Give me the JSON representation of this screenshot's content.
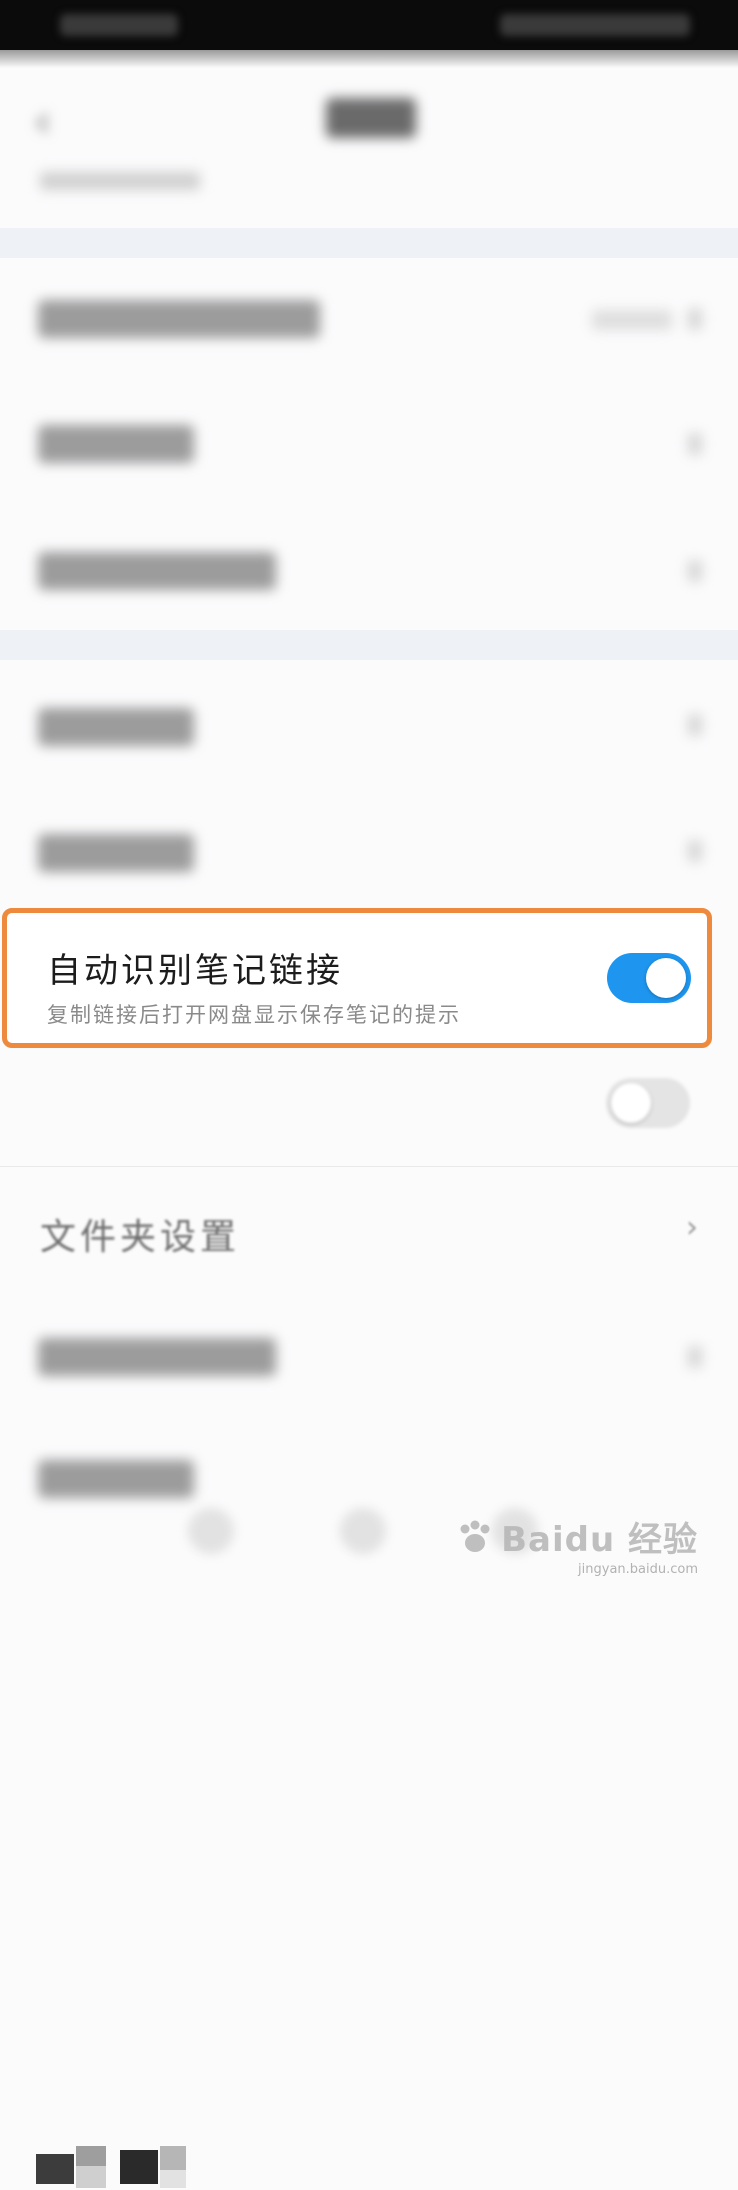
{
  "settings": {
    "auto_link": {
      "title": "自动识别笔记链接",
      "description": "复制链接后打开网盘显示保存笔记的提示",
      "toggle_on": true
    },
    "night_mode": {
      "toggle_on": false
    },
    "folder": {
      "title": "文件夹设置",
      "chevron": "›"
    }
  },
  "header": {
    "back_glyph": "‹"
  },
  "watermark": {
    "brand": "Baidu 经验",
    "site": "jingyan.baidu.com"
  },
  "colors": {
    "accent_blue": "#1e95ee",
    "highlight_orange": "#ee8a3e",
    "status_bar": "#0b0b0b"
  },
  "icons": [
    "back-arrow-icon",
    "chevron-right-icon",
    "paw-icon"
  ]
}
